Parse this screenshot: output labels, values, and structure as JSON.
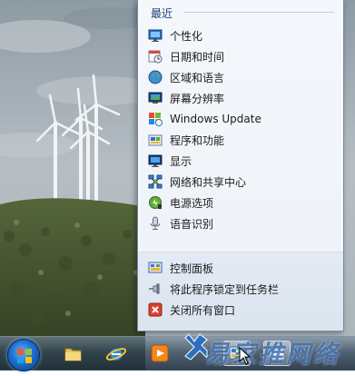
{
  "jump_list": {
    "recent_header": "最近",
    "recent_items": [
      {
        "label": "个性化",
        "icon": "personalization-icon"
      },
      {
        "label": "日期和时间",
        "icon": "date-time-icon"
      },
      {
        "label": "区域和语言",
        "icon": "region-language-icon"
      },
      {
        "label": "屏幕分辨率",
        "icon": "screen-resolution-icon"
      },
      {
        "label": "Windows Update",
        "icon": "windows-update-icon"
      },
      {
        "label": "程序和功能",
        "icon": "programs-features-icon"
      },
      {
        "label": "显示",
        "icon": "display-icon"
      },
      {
        "label": "网络和共享中心",
        "icon": "network-sharing-icon"
      },
      {
        "label": "电源选项",
        "icon": "power-options-icon"
      },
      {
        "label": "语音识别",
        "icon": "speech-recognition-icon"
      }
    ],
    "tasks": [
      {
        "label": "控制面板",
        "icon": "control-panel-icon"
      },
      {
        "label": "将此程序锁定到任务栏",
        "icon": "pin-icon"
      },
      {
        "label": "关闭所有窗口",
        "icon": "close-window-icon"
      }
    ]
  },
  "taskbar": {
    "pinned": [
      {
        "name": "explorer",
        "icon": "folder-icon"
      },
      {
        "name": "internet-explorer",
        "icon": "ie-icon"
      },
      {
        "name": "media-player",
        "icon": "media-player-icon"
      }
    ]
  },
  "watermark": "易家推网络"
}
